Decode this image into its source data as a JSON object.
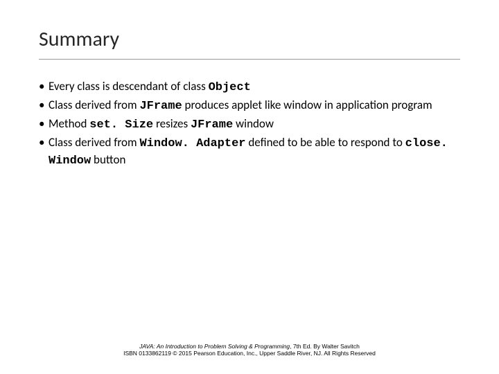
{
  "title": "Summary",
  "bullets": {
    "b1_a": "Every class is descendant of class ",
    "b1_code": "Object",
    "b2_a": "Class derived from ",
    "b2_code1": "JFrame",
    "b2_b": " produces applet like window in application program",
    "b3_a": "Method ",
    "b3_code1": "set. Size",
    "b3_b": " resizes ",
    "b3_code2": "JFrame",
    "b3_c": " window",
    "b4_a": "Class derived from ",
    "b4_code1": "Window. Adapter",
    "b4_b": " defined to be able to respond to ",
    "b4_code2": "close. Window",
    "b4_c": " button"
  },
  "footer": {
    "line1_book": "JAVA: An Introduction to Problem Solving & Programming",
    "line1_rest": ", 7th Ed. By Walter Savitch",
    "line2": "ISBN 0133862119 © 2015 Pearson Education, Inc., Upper Saddle River, NJ. All Rights Reserved"
  }
}
